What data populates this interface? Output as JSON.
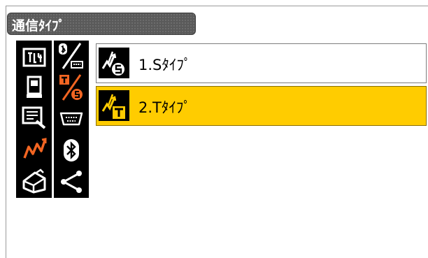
{
  "window": {
    "title": "通信ﾀｲﾌﾟ"
  },
  "sidebar": {
    "left_icons": [
      "instrument-config-icon",
      "total-station-icon",
      "document-edit-icon",
      "communication-icon",
      "toolbox-icon"
    ],
    "right_icons": [
      "bluetooth-rs232c-icon",
      "t-s-type-icon",
      "rs232c-port-icon",
      "bluetooth-icon",
      "share-icon"
    ],
    "active_left": "communication-icon",
    "active_right": "t-s-type-icon"
  },
  "options": [
    {
      "label": "1.Sﾀｲﾌﾟ",
      "icon": "s-type-icon",
      "selected": false
    },
    {
      "label": "2.Tﾀｲﾌﾟ",
      "icon": "t-type-icon",
      "selected": true
    }
  ],
  "colors": {
    "selection": "#ffcc00",
    "accent": "#f26522",
    "titlebar": "#5a5a5a"
  }
}
